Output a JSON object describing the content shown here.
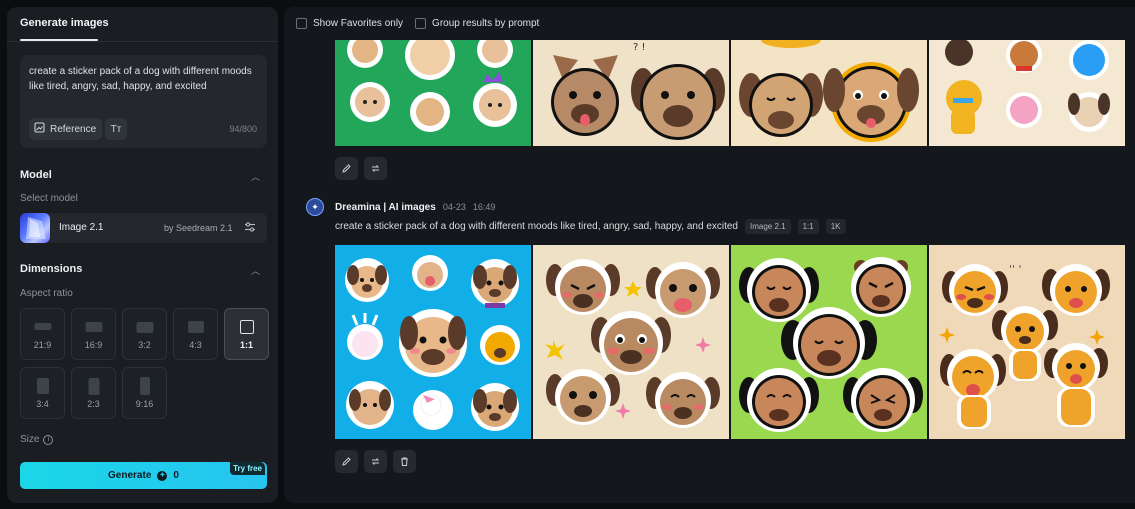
{
  "sidebar": {
    "tab_generate_images": "Generate images",
    "prompt": {
      "text": "create a sticker pack of a dog with different moods like tired, angry, sad, happy, and excited",
      "reference_label": "Reference",
      "text_tool_icon": "Tт",
      "char_count": "94/800"
    },
    "model": {
      "section_title": "Model",
      "select_label": "Select model",
      "name": "Image 2.1",
      "by": "by Seedream 2.1"
    },
    "dimensions": {
      "section_title": "Dimensions",
      "aspect_label": "Aspect ratio",
      "ratios": [
        {
          "label": "21:9"
        },
        {
          "label": "16:9"
        },
        {
          "label": "3:2"
        },
        {
          "label": "4:3"
        },
        {
          "label": "1:1"
        },
        {
          "label": "3:4"
        },
        {
          "label": "2:3"
        },
        {
          "label": "9:16"
        }
      ],
      "selected_ratio": "1:1",
      "size_label": "Size"
    },
    "generate": {
      "label": "Generate",
      "cost": "0",
      "try_free": "Try free"
    }
  },
  "main": {
    "filters": {
      "show_favorites": "Show Favorites only",
      "group_by_prompt": "Group results by prompt"
    },
    "result": {
      "brand": "Dreamina | AI images",
      "date": "04-23",
      "time": "16:49",
      "prompt": "create a sticker pack of a dog with different moods like tired, angry, sad, happy, and excited",
      "badges": [
        "Image 2.1",
        "1:1",
        "1K"
      ]
    }
  },
  "colors": {
    "accent": "#1ad7e8",
    "panel": "#1a1d22",
    "background": "#0b0d10"
  }
}
